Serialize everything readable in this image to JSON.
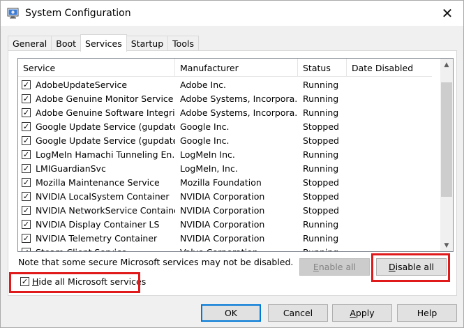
{
  "window": {
    "title": "System Configuration",
    "close_glyph": "✕",
    "icon": "msconfig-icon"
  },
  "tabs": [
    {
      "label": "General",
      "active": false
    },
    {
      "label": "Boot",
      "active": false
    },
    {
      "label": "Services",
      "active": true
    },
    {
      "label": "Startup",
      "active": false
    },
    {
      "label": "Tools",
      "active": false
    }
  ],
  "list": {
    "columns": [
      "Service",
      "Manufacturer",
      "Status",
      "Date Disabled"
    ],
    "rows": [
      {
        "checked": true,
        "service": "AdobeUpdateService",
        "manufacturer": "Adobe Inc.",
        "status": "Running",
        "date_disabled": ""
      },
      {
        "checked": true,
        "service": "Adobe Genuine Monitor Service",
        "manufacturer": "Adobe Systems, Incorpora...",
        "status": "Running",
        "date_disabled": ""
      },
      {
        "checked": true,
        "service": "Adobe Genuine Software Integri...",
        "manufacturer": "Adobe Systems, Incorpora...",
        "status": "Running",
        "date_disabled": ""
      },
      {
        "checked": true,
        "service": "Google Update Service (gupdate)",
        "manufacturer": "Google Inc.",
        "status": "Stopped",
        "date_disabled": ""
      },
      {
        "checked": true,
        "service": "Google Update Service (gupdate...",
        "manufacturer": "Google Inc.",
        "status": "Stopped",
        "date_disabled": ""
      },
      {
        "checked": true,
        "service": "LogMeIn Hamachi Tunneling En...",
        "manufacturer": "LogMeIn Inc.",
        "status": "Running",
        "date_disabled": ""
      },
      {
        "checked": true,
        "service": "LMIGuardianSvc",
        "manufacturer": "LogMeIn, Inc.",
        "status": "Running",
        "date_disabled": ""
      },
      {
        "checked": true,
        "service": "Mozilla Maintenance Service",
        "manufacturer": "Mozilla Foundation",
        "status": "Stopped",
        "date_disabled": ""
      },
      {
        "checked": true,
        "service": "NVIDIA LocalSystem Container",
        "manufacturer": "NVIDIA Corporation",
        "status": "Stopped",
        "date_disabled": ""
      },
      {
        "checked": true,
        "service": "NVIDIA NetworkService Container",
        "manufacturer": "NVIDIA Corporation",
        "status": "Stopped",
        "date_disabled": ""
      },
      {
        "checked": true,
        "service": "NVIDIA Display Container LS",
        "manufacturer": "NVIDIA Corporation",
        "status": "Running",
        "date_disabled": ""
      },
      {
        "checked": true,
        "service": "NVIDIA Telemetry Container",
        "manufacturer": "NVIDIA Corporation",
        "status": "Running",
        "date_disabled": ""
      },
      {
        "checked": true,
        "service": "Steam Client Service",
        "manufacturer": "Valve Corporation",
        "status": "Running",
        "date_disabled": ""
      }
    ]
  },
  "note": "Note that some secure Microsoft services may not be disabled.",
  "buttons": {
    "enable_all": {
      "pre": "",
      "mnemonic": "E",
      "post": "nable all",
      "disabled": true
    },
    "disable_all": {
      "pre": "",
      "mnemonic": "D",
      "post": "isable all",
      "disabled": false
    },
    "ok": "OK",
    "cancel": "Cancel",
    "apply": {
      "pre": "",
      "mnemonic": "A",
      "post": "pply"
    },
    "help": "Help"
  },
  "hide_ms": {
    "checked": true,
    "pre": "",
    "mnemonic": "H",
    "post": "ide all Microsoft services"
  },
  "colors": {
    "highlight": "#e0191b",
    "default_button_border": "#0078d7"
  }
}
